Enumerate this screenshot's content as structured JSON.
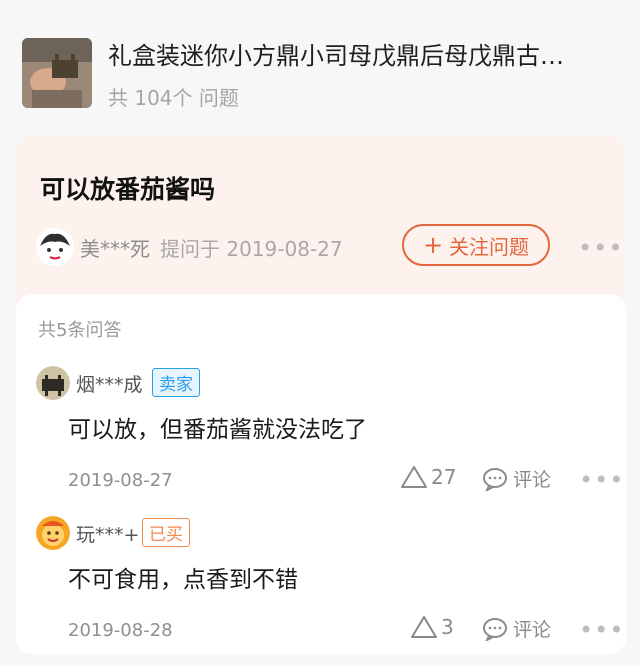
{
  "product": {
    "title": "礼盒装迷你小方鼎小司母戊鼎后母戊鼎古…",
    "question_total": "共 104个 问题"
  },
  "question": {
    "title": "可以放番茄酱吗",
    "asker": "美***死",
    "meta": "提问于 2019-08-27",
    "follow_label": "关注问题",
    "more": "•••"
  },
  "answers_header": "共5条问答",
  "answers": [
    {
      "user": "烟***成",
      "badge": "卖家",
      "text": "可以放，但番茄酱就没法吃了",
      "date": "2019-08-27",
      "likes": "27",
      "comment_label": "评论",
      "more": "•••"
    },
    {
      "user": "玩***+",
      "badge": "已买",
      "text": "不可食用，点香到不错",
      "date": "2019-08-28",
      "likes": "3",
      "comment_label": "评论",
      "more": "•••"
    }
  ],
  "colors": {
    "accent": "#e3663c",
    "seller_badge": "#2a9fe6",
    "bought_badge": "#f08a4b",
    "question_bg": "#fdf2ee"
  }
}
